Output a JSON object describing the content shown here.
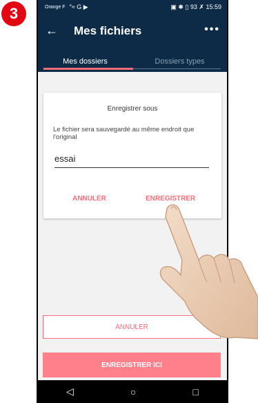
{
  "step_number": "3",
  "statusbar": {
    "operator": "Orange F",
    "signal_icons": "″≈ G ▶",
    "right": "▣ ✱ ▯ 93 ✗ 15:59"
  },
  "appbar": {
    "back_glyph": "←",
    "title": "Mes fichiers",
    "menu_glyph": "•••"
  },
  "tabs": [
    {
      "label": "Mes dossiers",
      "active": true
    },
    {
      "label": "Dossiers types",
      "active": false
    }
  ],
  "dialog": {
    "title": "Enregistrer sous",
    "message": "Le fichier sera sauvegardé au même endroit que l'original",
    "input_value": "essai",
    "cancel_label": "ANNULER",
    "save_label": "ENREGISTRER"
  },
  "bottom": {
    "cancel_label": "ANNULER",
    "save_here_label": "ENREGISTRER ICI"
  },
  "navbar": {
    "back": "◁",
    "home": "○",
    "recent": "□"
  },
  "colors": {
    "appbar": "#0d2b47",
    "accent": "#ff6b77",
    "step_badge": "#e30613"
  }
}
